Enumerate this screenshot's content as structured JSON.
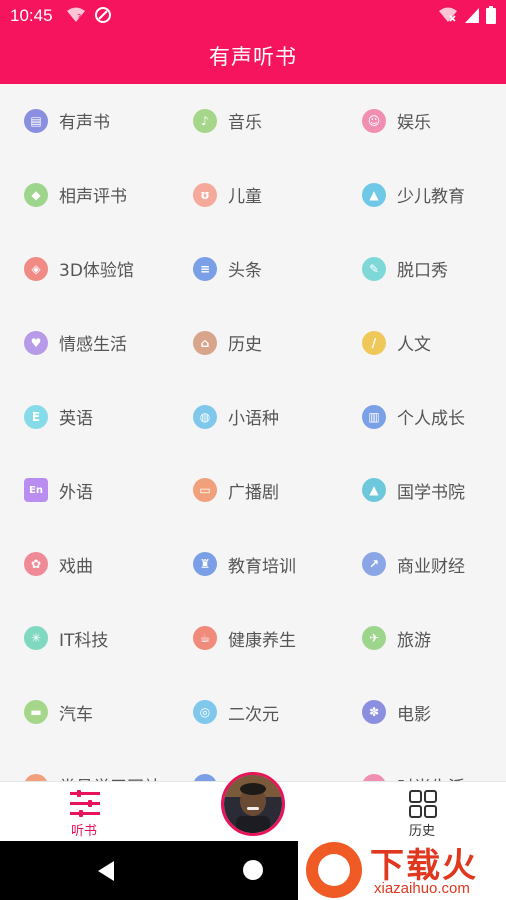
{
  "status_bar": {
    "time": "10:45"
  },
  "header": {
    "title": "有声听书"
  },
  "categories": [
    {
      "label": "有声书",
      "icon": "book-icon",
      "color": "#8b8fe0",
      "glyph": "▤"
    },
    {
      "label": "音乐",
      "icon": "music-note-icon",
      "color": "#a5d68a",
      "glyph": "♪"
    },
    {
      "label": "娱乐",
      "icon": "smile-icon",
      "color": "#f08fb2",
      "glyph": "☺"
    },
    {
      "label": "相声评书",
      "icon": "speech-bubble-icon",
      "color": "#9ed58c",
      "glyph": "◆"
    },
    {
      "label": "儿童",
      "icon": "bear-icon",
      "color": "#f5a99b",
      "glyph": "ʊ"
    },
    {
      "label": "少儿教育",
      "icon": "graduation-cap-icon",
      "color": "#6ec8e6",
      "glyph": "▲"
    },
    {
      "label": "3D体验馆",
      "icon": "cube-icon",
      "color": "#f08a84",
      "glyph": "◈"
    },
    {
      "label": "头条",
      "icon": "newspaper-icon",
      "color": "#7a9fe6",
      "glyph": "≡"
    },
    {
      "label": "脱口秀",
      "icon": "microphone-icon",
      "color": "#7fd8d8",
      "glyph": "✎"
    },
    {
      "label": "情感生活",
      "icon": "heart-icon",
      "color": "#b79be8",
      "glyph": "♥"
    },
    {
      "label": "历史",
      "icon": "temple-icon",
      "color": "#d8a48a",
      "glyph": "⌂"
    },
    {
      "label": "人文",
      "icon": "brush-icon",
      "color": "#f0c85a",
      "glyph": "/"
    },
    {
      "label": "英语",
      "icon": "english-book-icon",
      "color": "#85dbe8",
      "glyph": "E"
    },
    {
      "label": "小语种",
      "icon": "globe-icon",
      "color": "#7fc8ec",
      "glyph": "◍"
    },
    {
      "label": "个人成长",
      "icon": "growth-chart-icon",
      "color": "#7aa0e8",
      "glyph": "▥"
    },
    {
      "label": "外语",
      "icon": "en-card-icon",
      "color": "#b98ef0",
      "glyph": "En"
    },
    {
      "label": "广播剧",
      "icon": "radio-icon",
      "color": "#f0a07a",
      "glyph": "▭"
    },
    {
      "label": "国学书院",
      "icon": "graduation-cap-icon",
      "color": "#6ec8dc",
      "glyph": "▲"
    },
    {
      "label": "戏曲",
      "icon": "opera-mask-icon",
      "color": "#f08a96",
      "glyph": "✿"
    },
    {
      "label": "教育培训",
      "icon": "trophy-icon",
      "color": "#7a9fe6",
      "glyph": "♜"
    },
    {
      "label": "商业财经",
      "icon": "finance-chart-icon",
      "color": "#8aa6e6",
      "glyph": "↗"
    },
    {
      "label": "IT科技",
      "icon": "atom-icon",
      "color": "#7fd8c0",
      "glyph": "✳"
    },
    {
      "label": "健康养生",
      "icon": "teacup-icon",
      "color": "#f08a7a",
      "glyph": "☕"
    },
    {
      "label": "旅游",
      "icon": "airplane-icon",
      "color": "#9ed58c",
      "glyph": "✈"
    },
    {
      "label": "汽车",
      "icon": "car-icon",
      "color": "#a5d68a",
      "glyph": "▬"
    },
    {
      "label": "二次元",
      "icon": "gamepad-icon",
      "color": "#7fc8ec",
      "glyph": "◎"
    },
    {
      "label": "电影",
      "icon": "film-reel-icon",
      "color": "#8b8fe0",
      "glyph": "✽"
    },
    {
      "label": "常見学习网站",
      "icon": "partial-icon",
      "color": "#f0a07a",
      "glyph": ""
    },
    {
      "label": "",
      "icon": "partial-icon",
      "color": "#7a9fe6",
      "glyph": ""
    },
    {
      "label": "时尚生活",
      "icon": "partial-icon",
      "color": "#f08fb2",
      "glyph": ""
    }
  ],
  "tabbar": {
    "listen_label": "听书",
    "history_label": "历史"
  },
  "watermark": {
    "brand": "下载火",
    "url": "xiazaihuo.com"
  },
  "colors": {
    "accent": "#f5145d",
    "active_tab": "#e8145a"
  }
}
